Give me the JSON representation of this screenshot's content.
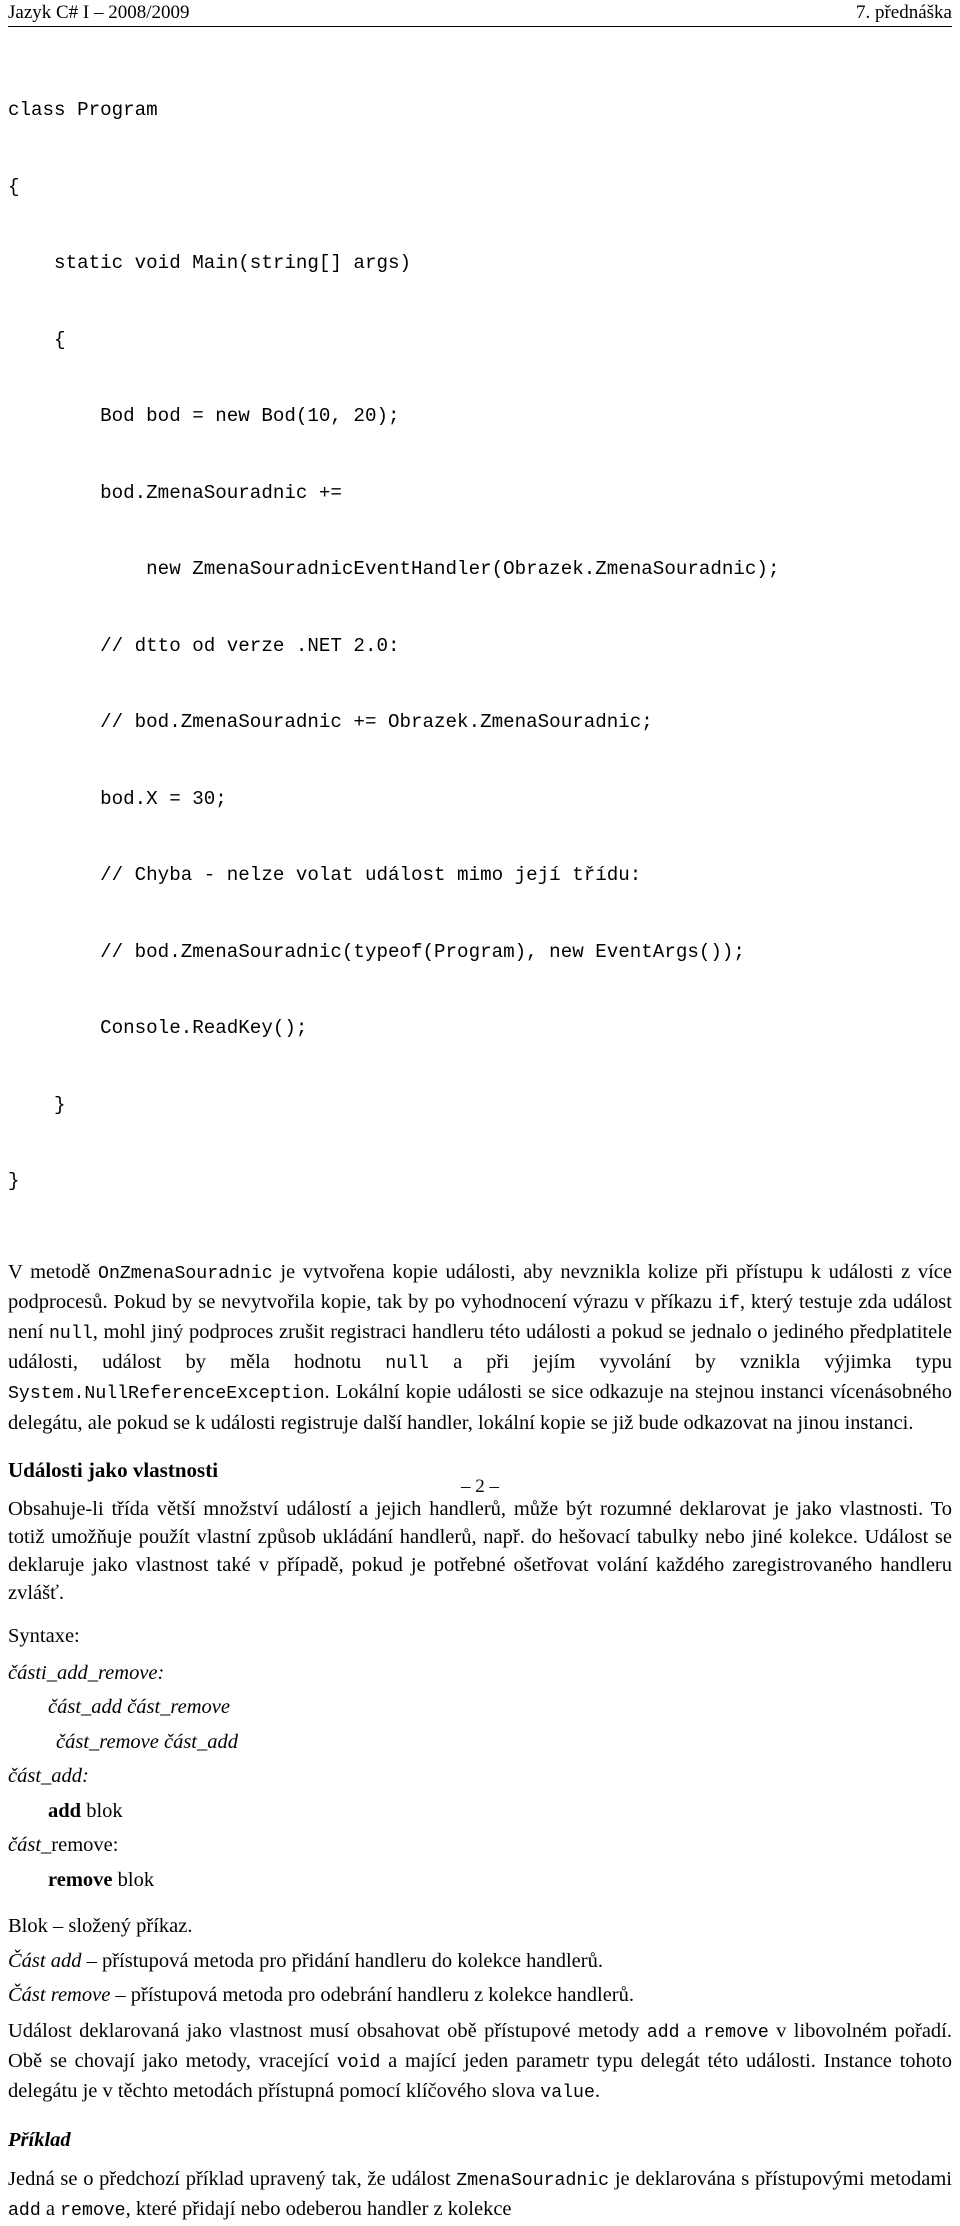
{
  "header": {
    "left": "Jazyk C# I – 2008/2009",
    "right": "7. přednáška"
  },
  "code_block": {
    "language": "csharp",
    "lines": [
      "class Program",
      "{",
      "    static void Main(string[] args)",
      "    {",
      "        Bod bod = new Bod(10, 20);",
      "        bod.ZmenaSouradnic +=",
      "            new ZmenaSouradnicEventHandler(Obrazek.ZmenaSouradnic);",
      "        // dtto od verze .NET 2.0:",
      "        // bod.ZmenaSouradnic += Obrazek.ZmenaSouradnic;",
      "        bod.X = 30;",
      "        // Chyba - nelze volat událost mimo její třídu:",
      "        // bod.ZmenaSouradnic(typeof(Program), new EventArgs());",
      "        Console.ReadKey();",
      "    }",
      "}"
    ]
  },
  "paragraph_copy": {
    "p1_a": "V metodě ",
    "p1_code1": "OnZmenaSouradnic",
    "p1_b": " je vytvořena kopie události, aby nevznikla kolize při přístupu k události z více podprocesů. Pokud by se nevytvořila kopie, tak by po vyhodnocení výrazu v příkazu ",
    "p1_code2": "if",
    "p1_c": ", který testuje zda událost není ",
    "p1_code3": "null",
    "p1_d": ", mohl jiný podproces zrušit registraci handleru této události a pokud se jednalo o jediného předplatitele události, událost by měla hodnotu ",
    "p1_code4": "null",
    "p1_e": " a při jejím vyvolání by vznikla výjimka typu ",
    "p1_code5": "System.NullReferenceException",
    "p1_f": ". Lokální kopie události se sice odkazuje na stejnou instanci vícenásobného delegátu, ale pokud se k události registruje další handler, lokální kopie se již bude odkazovat na jinou instanci."
  },
  "section_properties": {
    "heading": "Události jako vlastnosti",
    "paragraph": "Obsahuje-li třída větší množství událostí a jejich handlerů, může být rozumné deklarovat je jako vlastnosti. To totiž umožňuje použít vlastní způsob ukládání handlerů, např. do hešovací tabulky nebo jiné kolekce. Událost se deklaruje jako vlastnost také v případě, pokud je potřebné ošetřovat volání každého zaregistrovaného handleru zvlášť."
  },
  "syntax": {
    "label": "Syntaxe:",
    "rules": [
      {
        "indent": 0,
        "type": "rule-head",
        "name": "části_add_remove",
        "suffix": ":"
      },
      {
        "indent": 1,
        "type": "production",
        "text": "část_add část_remove"
      },
      {
        "indent": 2,
        "type": "production",
        "text": "část_remove část_add"
      },
      {
        "indent": 0,
        "type": "rule-head",
        "name": "část_add",
        "suffix": ":"
      },
      {
        "indent": 1,
        "type": "keyword-production",
        "keyword": "add",
        "rest": " blok"
      },
      {
        "indent": 0,
        "type": "rule-head-mixed",
        "italic": "část",
        "plain": "_remove:"
      },
      {
        "indent": 1,
        "type": "keyword-production",
        "keyword": "remove",
        "rest": " blok"
      }
    ]
  },
  "definitions": [
    {
      "term": "",
      "plain_lead": "Blok",
      "text": " – složený příkaz."
    },
    {
      "term": "Část add",
      "plain_lead": "",
      "text": " – přístupová metoda pro přidání handleru do kolekce handlerů."
    },
    {
      "term": "Část remove",
      "plain_lead": "",
      "text": " – přístupová metoda pro odebrání handleru z kolekce handlerů."
    }
  ],
  "closing_paragraph": {
    "a": "Událost deklarovaná jako vlastnost musí obsahovat obě přístupové metody ",
    "code1": "add",
    "b": " a ",
    "code2": "remove",
    "c": " v libovolném pořadí. Obě se chovají jako metody, vracející ",
    "code3": "void",
    "d": " a mající jeden parametr typu delegát této události. Instance tohoto delegátu je v těchto metodách přístupná pomocí klíčového slova ",
    "code4": "value",
    "e": "."
  },
  "example_section": {
    "heading": "Příklad",
    "a": "Jedná se o předchozí příklad upravený tak, že událost ",
    "code1": "ZmenaSouradnic",
    "b": " je deklarována s přístupovými metodami ",
    "code2": "add",
    "c": " a ",
    "code3": "remove",
    "d": ", které přidají nebo odeberou handler z kolekce"
  },
  "footer": {
    "page_marker": "– 2 –"
  }
}
